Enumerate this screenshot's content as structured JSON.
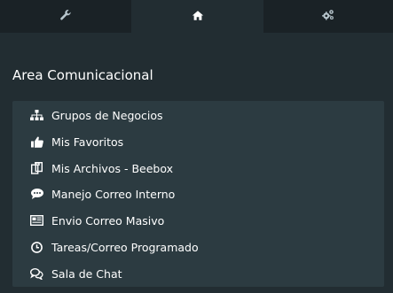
{
  "tabs": [
    {
      "icon": "wrench-icon",
      "active": false
    },
    {
      "icon": "home-icon",
      "active": true
    },
    {
      "icon": "gears-icon",
      "active": false
    }
  ],
  "section": {
    "title": "Area Comunicacional"
  },
  "menu": {
    "items": [
      {
        "label": "Grupos de Negocios",
        "icon": "sitemap-icon"
      },
      {
        "label": "Mis Favoritos",
        "icon": "thumbs-up-icon"
      },
      {
        "label": "Mis Archivos - Beebox",
        "icon": "files-icon"
      },
      {
        "label": "Manejo Correo Interno",
        "icon": "comment-icon"
      },
      {
        "label": "Envio Correo Masivo",
        "icon": "newspaper-icon"
      },
      {
        "label": "Tareas/Correo Programado",
        "icon": "clock-icon"
      },
      {
        "label": "Sala de Chat",
        "icon": "chat-icon"
      }
    ]
  },
  "colors": {
    "background": "#222d32",
    "tabbar": "#1a2226",
    "menu_bg": "#2c3b41",
    "text": "#ffffff",
    "muted": "#b8c7ce"
  }
}
